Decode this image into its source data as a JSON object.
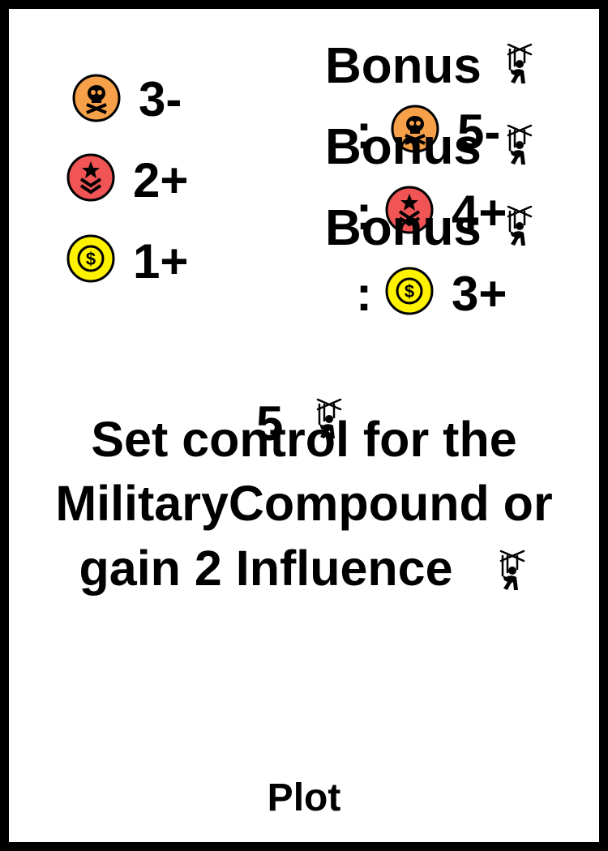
{
  "requirements": [
    {
      "icon": "skull-icon",
      "color": "#F7A04A",
      "value": "3-"
    },
    {
      "icon": "military-rank-icon",
      "color": "#F05454",
      "value": "2+"
    },
    {
      "icon": "dollar-coin-icon",
      "color": "#FFF200",
      "value": "1+"
    }
  ],
  "bonuses": [
    {
      "label": "Bonus",
      "colon": ":",
      "icon": "skull-icon",
      "color": "#F7A04A",
      "value": "5-"
    },
    {
      "label": "Bonus",
      "colon": ":",
      "icon": "military-rank-icon",
      "color": "#F05454",
      "value": "4+"
    },
    {
      "label": "Bonus",
      "colon": ":",
      "icon": "dollar-coin-icon",
      "color": "#FFF200",
      "value": "3+"
    }
  ],
  "cost": {
    "value": "5",
    "icon": "puppet-influence-icon"
  },
  "effect": {
    "line1": "Set control for the",
    "line2": "MilitaryCompound  or",
    "line3": "gain  2  Influence",
    "line3_icon": "puppet-influence-icon"
  },
  "card_type": "Plot"
}
